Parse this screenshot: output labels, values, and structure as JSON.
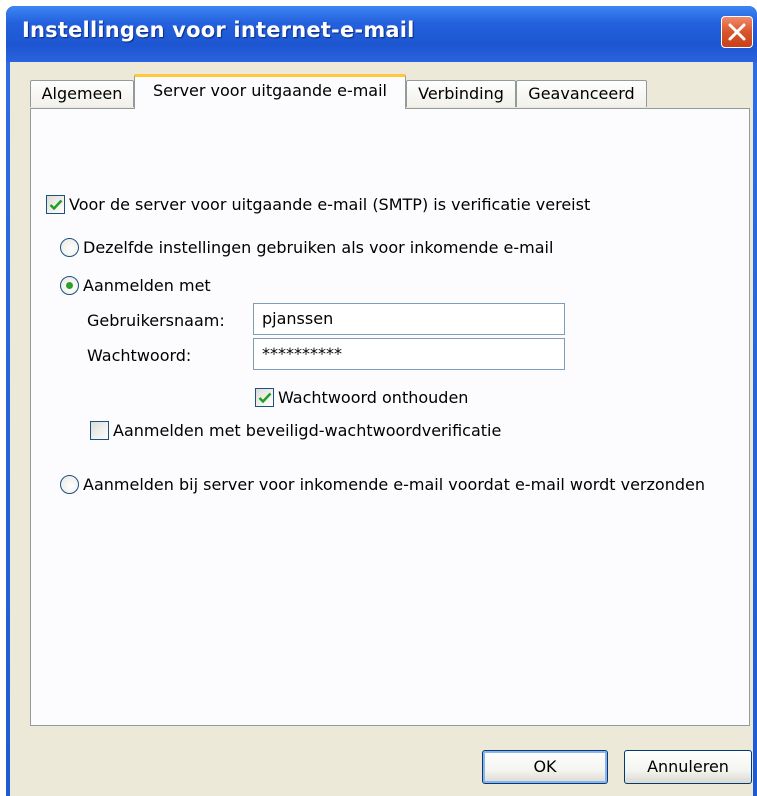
{
  "window": {
    "title": "Instellingen voor internet-e-mail"
  },
  "tabs": [
    {
      "label": "Algemeen",
      "active": false
    },
    {
      "label": "Server voor uitgaande e-mail",
      "active": true
    },
    {
      "label": "Verbinding",
      "active": false
    },
    {
      "label": "Geavanceerd",
      "active": false
    }
  ],
  "smtp_auth": {
    "label": "Voor de server voor uitgaande e-mail (SMTP) is verificatie vereist",
    "checked": true
  },
  "options": {
    "same_settings_label": "Dezelfde instellingen gebruiken als voor inkomende e-mail",
    "login_with_label": "Aanmelden met",
    "login_incoming_first_label": "Aanmelden bij server voor inkomende e-mail voordat e-mail wordt verzonden",
    "selected": "login_with"
  },
  "credentials": {
    "username_label": "Gebruikersnaam:",
    "username_value": "pjanssen",
    "password_label": "Wachtwoord:",
    "password_value": "**********",
    "remember_label": "Wachtwoord onthouden",
    "remember_checked": true,
    "spa_label": "Aanmelden met beveiligd-wachtwoordverificatie",
    "spa_checked": false
  },
  "buttons": {
    "ok_label": "OK",
    "cancel_label": "Annuleren"
  },
  "colors": {
    "titlebar": "#245edb",
    "dialog_face": "#ece9d8",
    "active_tab_accent": "#ffc83c",
    "check_mark": "#21a121"
  }
}
